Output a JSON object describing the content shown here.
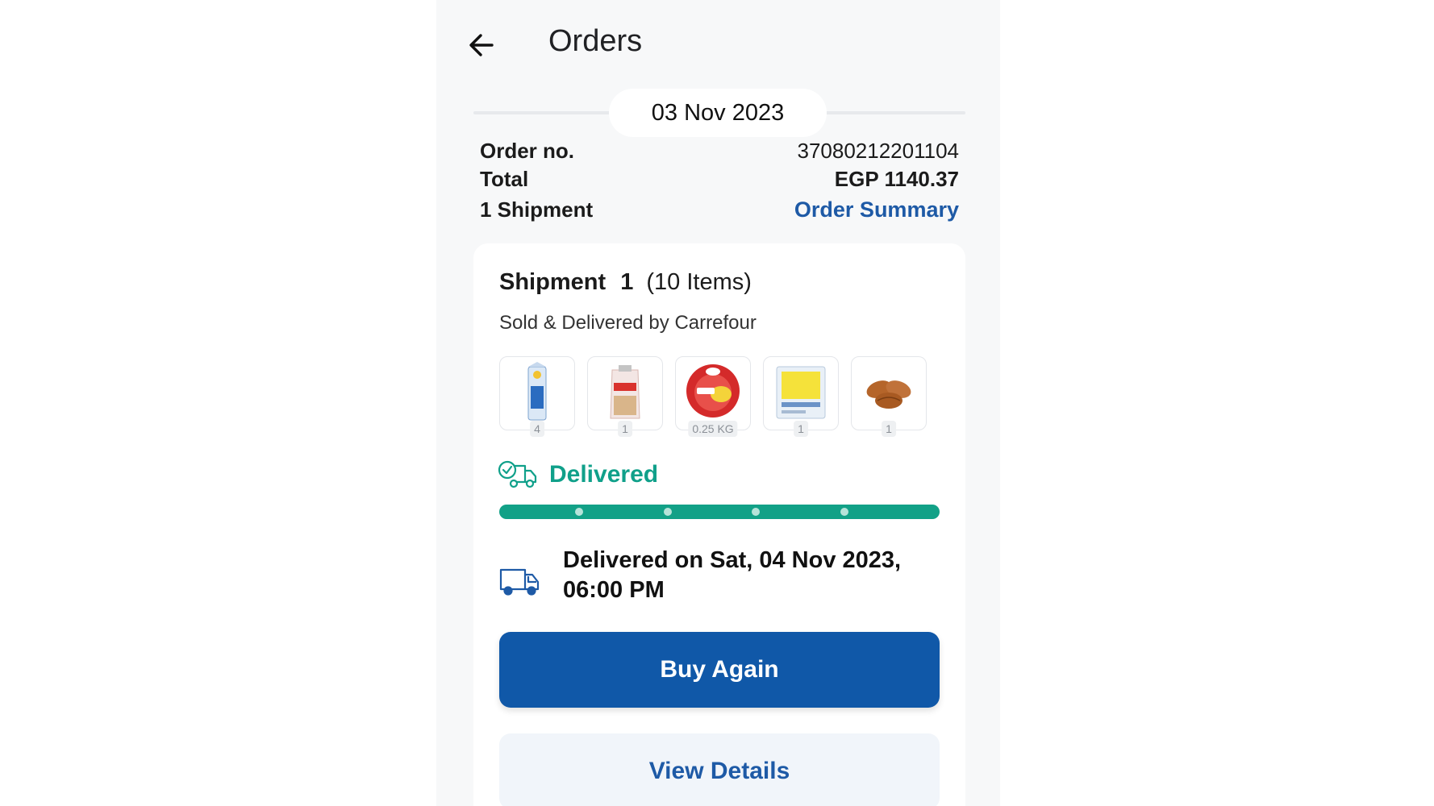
{
  "header": {
    "title": "Orders",
    "back_icon": "arrow-left-icon"
  },
  "order": {
    "date": "03 Nov 2023",
    "order_no_label": "Order no.",
    "order_no_value": "37080212201104",
    "total_label": "Total",
    "total_value": "EGP 1140.37",
    "shipments_label": "1 Shipment",
    "summary_link": "Order Summary"
  },
  "shipment": {
    "title": "Shipment",
    "number": "1",
    "items_text": "(10  Items)",
    "seller": "Sold & Delivered by Carrefour",
    "products": [
      {
        "icon": "milk-carton-icon",
        "qty": "4"
      },
      {
        "icon": "bread-bag-icon",
        "qty": "1"
      },
      {
        "icon": "edam-cheese-icon",
        "qty": "0.25 KG"
      },
      {
        "icon": "cheese-slices-icon",
        "qty": "1"
      },
      {
        "icon": "croissants-icon",
        "qty": "1"
      }
    ],
    "status": "Delivered",
    "status_color": "#10a08a",
    "progress_fraction": 1.0,
    "delivered_line1": "Delivered on Sat, 04 Nov 2023,",
    "delivered_line2": "06:00 PM"
  },
  "actions": {
    "buy_again": "Buy Again",
    "view_details": "View Details",
    "primary_color": "#1058a8",
    "link_color": "#1e5aa6"
  }
}
